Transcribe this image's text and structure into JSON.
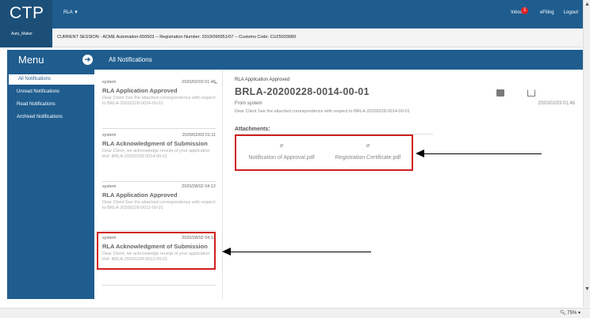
{
  "app": {
    "logo": "CTP",
    "rla_menu": "RLA ▼",
    "user": "Auto_Maker"
  },
  "topbar": {
    "inbox_label": "Inbox",
    "inbox_count": "1",
    "efiling": "eFiling",
    "logout": "Logout"
  },
  "session": {
    "text": "CURRENT SESSION - ACME Automation-656503 -- Registration Number: 2019/096951/07 -- Customs Code: CU25003689"
  },
  "panel": {
    "menu_title": "Menu",
    "menu_toggle": "➔",
    "title": "All Notifications"
  },
  "sidebar": {
    "items": [
      {
        "label": "All Notifications"
      },
      {
        "label": "Unread Notifications"
      },
      {
        "label": "Read Notifications"
      },
      {
        "label": "Archived Notifications"
      }
    ]
  },
  "notifications": [
    {
      "sender": "system",
      "date": "2020/02/03 01:46",
      "title": "RLA Application Approved",
      "body": "Dear Client See the attached correspondence with respect to BRLA-20200228-0014-00-01"
    },
    {
      "sender": "system",
      "date": "2020/02/03 01:11",
      "title": "RLA Acknowledgment of Submission",
      "body": "Dear Client, we acknowledge receipt of your application Ref: BRLA-20200228-0014-00-01"
    },
    {
      "sender": "system",
      "date": "2020/28/02 04:12",
      "title": "RLA Application Approved",
      "body": "Dear Client See the attached correspondence with respect to BRLA-20200228-0012-00-01"
    },
    {
      "sender": "system",
      "date": "2020/28/02 04:12",
      "title": "RLA Acknowledgment of Submission",
      "body": "Dear Client, we acknowledge receipt of your application Ref: BRLA-20200228-0012-00-01"
    }
  ],
  "detail": {
    "subtitle": "RLA Application Approved",
    "title": "BRLA-20200228-0014-00-01",
    "from": "From system",
    "date": "2020/02/03 01:46",
    "text": "Dear Client See the attached correspondence with respect to BRLA-20200228-0014-00-01",
    "attachments_label": "Attachments:",
    "attachments": [
      {
        "icon": "paperclip-icon",
        "name": "Notification of Approval.pdf"
      },
      {
        "icon": "paperclip-icon",
        "name": "Registration Certificate.pdf"
      }
    ]
  },
  "status": {
    "zoom": "75%"
  },
  "colors": {
    "header_blue": "#1f5d8f",
    "highlight_red": "#d02020"
  }
}
